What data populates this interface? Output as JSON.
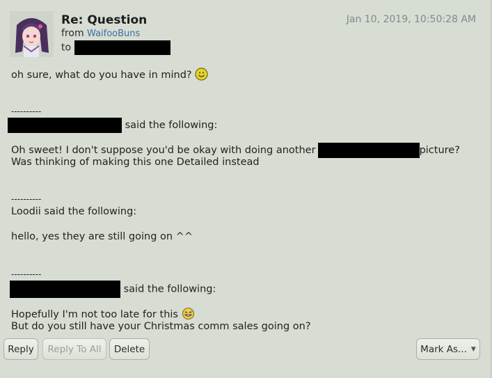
{
  "header": {
    "subject": "Re: Question",
    "from_label": "from",
    "sender": "WaifooBuns",
    "to_label": "to",
    "timestamp": "Jan 10, 2019, 10:50:28 AM"
  },
  "message": {
    "reply_line": "oh sure, what do you have in mind?",
    "separator": "----------",
    "quote1_said": "said the following:",
    "quote1_line1_a": "Oh sweet! I don't suppose you'd be okay with doing another",
    "quote1_line1_b": "picture?",
    "quote1_line2": "Was thinking of making this one Detailed instead",
    "quote2_said": "Loodii said the following:",
    "quote2_line1": "hello, yes they are still going on ^^",
    "quote3_said": "said the following:",
    "quote3_line1": "Hopefully I'm not too late for this",
    "quote3_line2": "But do you still have your Christmas comm sales going on?"
  },
  "actions": {
    "reply": "Reply",
    "reply_all": "Reply To All",
    "delete": "Delete",
    "mark_as": "Mark As..."
  },
  "icons": {
    "smile": "smiley-face-icon",
    "sweat": "sweat-smile-icon",
    "dropdown": "triangle-down-icon"
  }
}
